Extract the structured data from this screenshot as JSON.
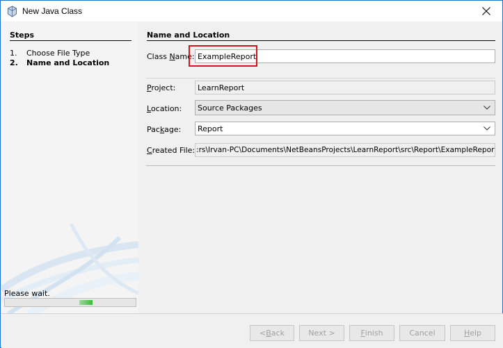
{
  "window": {
    "title": "New Java Class"
  },
  "steps": {
    "heading": "Steps",
    "items": [
      {
        "number": "1.",
        "label": "Choose File Type",
        "current": false
      },
      {
        "number": "2.",
        "label": "Name and Location",
        "current": true
      }
    ],
    "status_text": "Please wait.",
    "progress_fraction": 0.1
  },
  "form": {
    "heading": "Name and Location",
    "class_name": {
      "label_pre": "Class ",
      "label_mnemonic": "N",
      "label_post": "ame:",
      "value": "ExampleReport"
    },
    "project": {
      "label_pre": "",
      "label_mnemonic": "P",
      "label_post": "roject:",
      "value": "LearnReport"
    },
    "location": {
      "label_pre": "",
      "label_mnemonic": "L",
      "label_post": "ocation:",
      "value": "Source Packages"
    },
    "package": {
      "label_pre": "Pac",
      "label_mnemonic": "k",
      "label_post": "age:",
      "value": "Report"
    },
    "created_file": {
      "label_pre": "",
      "label_mnemonic": "C",
      "label_post": "reated File:",
      "value": ":rs\\Irvan-PC\\Documents\\NetBeansProjects\\LearnReport\\src\\Report\\ExampleReport.java"
    }
  },
  "buttons": {
    "back": {
      "pre": "< ",
      "mnemonic": "B",
      "post": "ack"
    },
    "next": {
      "pre": "Next >",
      "mnemonic": "",
      "post": ""
    },
    "finish": {
      "pre": "",
      "mnemonic": "F",
      "post": "inish"
    },
    "cancel": {
      "pre": "Cancel",
      "mnemonic": "",
      "post": ""
    },
    "help": {
      "pre": "",
      "mnemonic": "H",
      "post": "elp"
    }
  },
  "icons": {
    "app": "java-class-cup-icon",
    "close": "close-icon",
    "location_dropdown": "chevron-down-icon",
    "package_dropdown": "chevron-down-icon"
  },
  "colors": {
    "highlight_box": "#d4161c",
    "window_border": "#1e73c8",
    "progress_fill": "#3cb93c"
  }
}
